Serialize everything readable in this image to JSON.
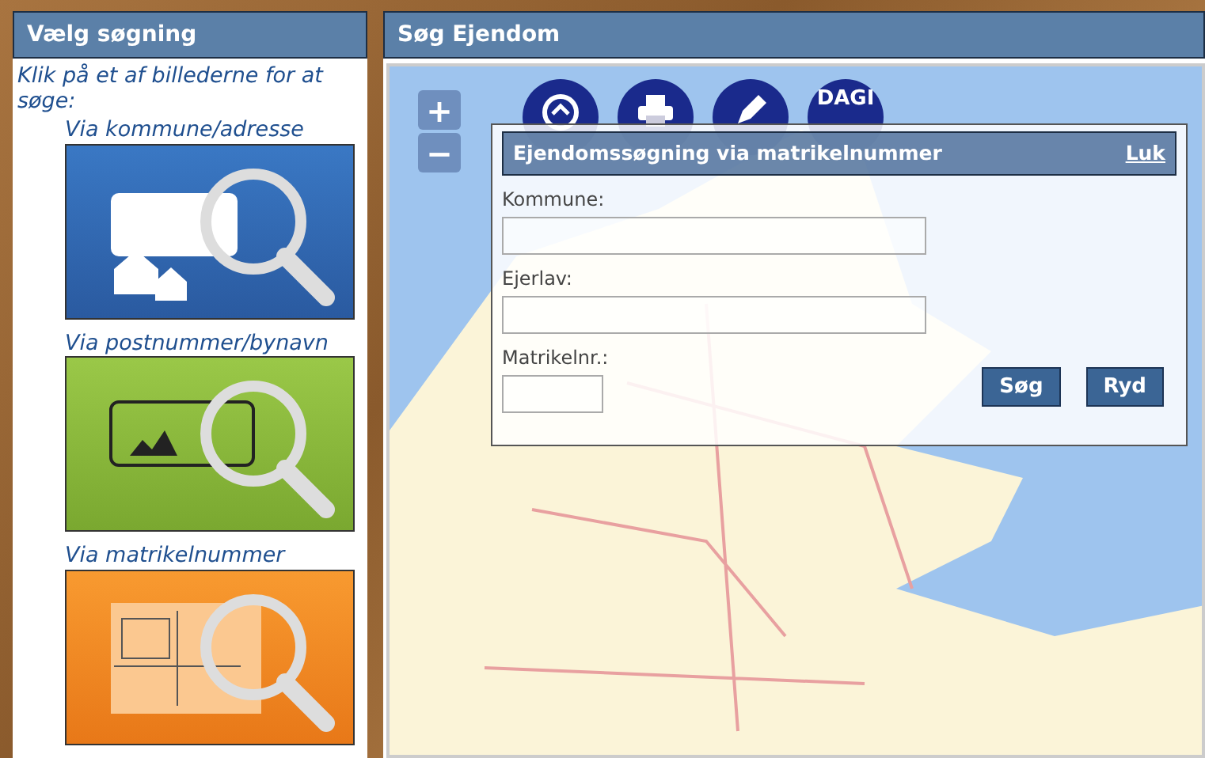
{
  "left_panel": {
    "title": "Vælg søgning",
    "intro": "Klik på et af billederne for at søge:",
    "options": [
      {
        "label": "Via kommune/adresse",
        "kind": "kommune"
      },
      {
        "label": "Via postnummer/bynavn",
        "kind": "postnummer"
      },
      {
        "label": "Via matrikelnummer",
        "kind": "matrikel"
      }
    ]
  },
  "main_panel": {
    "title": "Søg Ejendom",
    "zoom": [
      "+",
      "−"
    ],
    "map_tools": [
      {
        "kind": "home-search"
      },
      {
        "kind": "print"
      },
      {
        "kind": "pencil"
      },
      {
        "kind": "text",
        "label": "DAGI"
      }
    ],
    "dialog": {
      "title": "Ejendomssøgning via matrikelnummer",
      "close": "Luk",
      "fields": [
        {
          "label": "Kommune:",
          "kind": "wide"
        },
        {
          "label": "Ejerlav:",
          "kind": "wide"
        },
        {
          "label": "Matrikelnr.:",
          "kind": "short"
        }
      ],
      "buttons": [
        "Søg",
        "Ryd"
      ]
    }
  }
}
